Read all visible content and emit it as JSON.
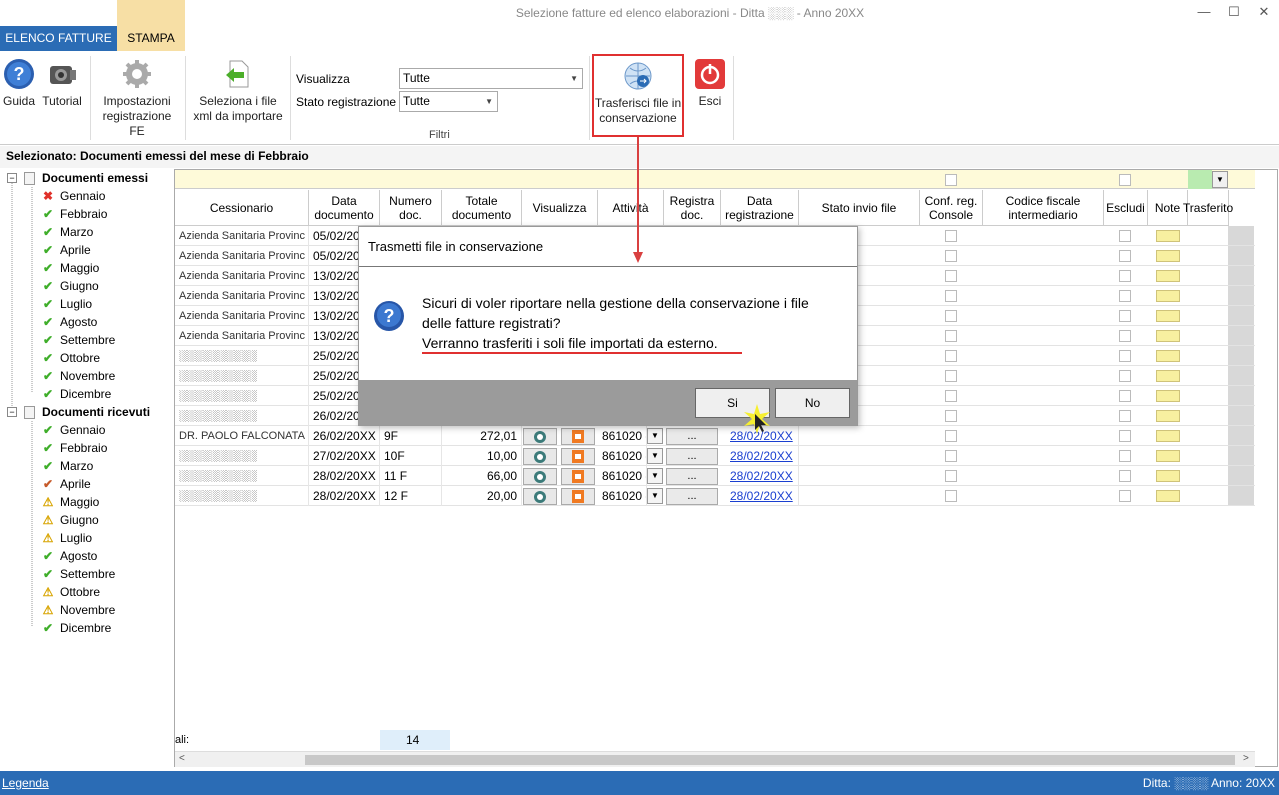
{
  "window": {
    "title": "Selezione fatture ed elenco elaborazioni - Ditta ░░░ - Anno 20XX",
    "minimize": "—",
    "maximize": "☐",
    "close": "✕"
  },
  "ribbon": {
    "tabs": [
      "ELENCO FATTURE",
      "STAMPA"
    ],
    "guida": "Guida",
    "tutorial": "Tutorial",
    "impostazioni_1": "Impostazioni",
    "impostazioni_2": "registrazione FE",
    "seleziona_1": "Seleziona i file",
    "seleziona_2": "xml da importare",
    "visualizza_label": "Visualizza",
    "visualizza_value": "Tutte",
    "stato_label": "Stato registrazione",
    "stato_value": "Tutte",
    "filtri": "Filtri",
    "trasferisci_1": "Trasferisci file in",
    "trasferisci_2": "conservazione",
    "esci": "Esci"
  },
  "selected": "Selezionato: Documenti emessi del mese di Febbraio",
  "tree": {
    "emessi": "Documenti emessi",
    "ricevuti": "Documenti ricevuti",
    "emessi_months": [
      {
        "label": "Gennaio",
        "status": "err"
      },
      {
        "label": "Febbraio",
        "status": "ok"
      },
      {
        "label": "Marzo",
        "status": "ok"
      },
      {
        "label": "Aprile",
        "status": "ok"
      },
      {
        "label": "Maggio",
        "status": "ok"
      },
      {
        "label": "Giugno",
        "status": "ok"
      },
      {
        "label": "Luglio",
        "status": "ok"
      },
      {
        "label": "Agosto",
        "status": "ok"
      },
      {
        "label": "Settembre",
        "status": "ok"
      },
      {
        "label": "Ottobre",
        "status": "ok"
      },
      {
        "label": "Novembre",
        "status": "ok"
      },
      {
        "label": "Dicembre",
        "status": "ok"
      }
    ],
    "ricevuti_months": [
      {
        "label": "Gennaio",
        "status": "ok"
      },
      {
        "label": "Febbraio",
        "status": "ok"
      },
      {
        "label": "Marzo",
        "status": "ok"
      },
      {
        "label": "Aprile",
        "status": "mixed"
      },
      {
        "label": "Maggio",
        "status": "warn"
      },
      {
        "label": "Giugno",
        "status": "warn"
      },
      {
        "label": "Luglio",
        "status": "warn"
      },
      {
        "label": "Agosto",
        "status": "ok"
      },
      {
        "label": "Settembre",
        "status": "ok"
      },
      {
        "label": "Ottobre",
        "status": "warn"
      },
      {
        "label": "Novembre",
        "status": "warn"
      },
      {
        "label": "Dicembre",
        "status": "ok"
      }
    ]
  },
  "grid": {
    "headers": {
      "cessionario": "Cessionario",
      "data_doc": "Data documento",
      "numero": "Numero doc.",
      "totale": "Totale documento",
      "visualizza": "Visualizza",
      "attivita": "Attività",
      "registra": "Registra doc.",
      "data_reg": "Data registrazione",
      "stato": "Stato invio file",
      "conf": "Conf. reg. Console",
      "codice": "Codice fiscale intermediario",
      "escludi": "Escludi",
      "note": "Note",
      "trasferito": "Trasferito"
    },
    "rows": [
      {
        "cessionario": "Azienda Sanitaria Provinc",
        "data": "05/02/20",
        "numero": "",
        "totale": "",
        "attivita": "",
        "data_reg": ""
      },
      {
        "cessionario": "Azienda Sanitaria Provinc",
        "data": "05/02/20",
        "numero": "",
        "totale": "",
        "attivita": "",
        "data_reg": ""
      },
      {
        "cessionario": "Azienda Sanitaria Provinc",
        "data": "13/02/20",
        "numero": "",
        "totale": "",
        "attivita": "",
        "data_reg": ""
      },
      {
        "cessionario": "Azienda Sanitaria Provinc",
        "data": "13/02/20",
        "numero": "",
        "totale": "",
        "attivita": "",
        "data_reg": ""
      },
      {
        "cessionario": "Azienda Sanitaria Provinc",
        "data": "13/02/20",
        "numero": "",
        "totale": "",
        "attivita": "",
        "data_reg": ""
      },
      {
        "cessionario": "Azienda Sanitaria Provinc",
        "data": "13/02/20",
        "numero": "",
        "totale": "",
        "attivita": "",
        "data_reg": ""
      },
      {
        "cessionario": "░░░░░░░░░░",
        "data": "25/02/20",
        "numero": "",
        "totale": "",
        "attivita": "",
        "data_reg": ""
      },
      {
        "cessionario": "░░░░░░░░░░",
        "data": "25/02/20",
        "numero": "",
        "totale": "",
        "attivita": "",
        "data_reg": ""
      },
      {
        "cessionario": "░░░░░░░░░░",
        "data": "25/02/20",
        "numero": "",
        "totale": "",
        "attivita": "",
        "data_reg": ""
      },
      {
        "cessionario": "░░░░░░░░░░",
        "data": "26/02/20",
        "numero": "",
        "totale": "",
        "attivita": "",
        "data_reg": ""
      },
      {
        "cessionario": "DR. PAOLO FALCONATA",
        "data": "26/02/20XX",
        "numero": "9F",
        "totale": "272,01",
        "attivita": "861020 -",
        "data_reg": "28/02/20XX"
      },
      {
        "cessionario": "░░░░░░░░░░",
        "data": "27/02/20XX",
        "numero": "10F",
        "totale": "10,00",
        "attivita": "861020 -",
        "data_reg": "28/02/20XX"
      },
      {
        "cessionario": "░░░░░░░░░░",
        "data": "28/02/20XX",
        "numero": "11 F",
        "totale": "66,00",
        "attivita": "861020 -",
        "data_reg": "28/02/20XX"
      },
      {
        "cessionario": "░░░░░░░░░░",
        "data": "28/02/20XX",
        "numero": "12 F",
        "totale": "20,00",
        "attivita": "861020 -",
        "data_reg": "28/02/20XX"
      }
    ],
    "totals_label": "ali:",
    "totals_count": "14",
    "dots": "..."
  },
  "dialog": {
    "title": "Trasmetti file in conservazione",
    "line1": "Sicuri di voler riportare nella gestione della conservazione i file",
    "line2": "delle fatture registrati?",
    "line3": "Verranno trasferiti i soli file importati da esterno.",
    "yes": "Si",
    "no": "No"
  },
  "status": {
    "legenda": "Legenda",
    "ditta": "Ditta: ░░░░ Anno: 20XX"
  },
  "colors": {
    "accent": "#2b6cb5",
    "highlight_red": "#e03030",
    "filter_yellow": "#fefad9"
  }
}
